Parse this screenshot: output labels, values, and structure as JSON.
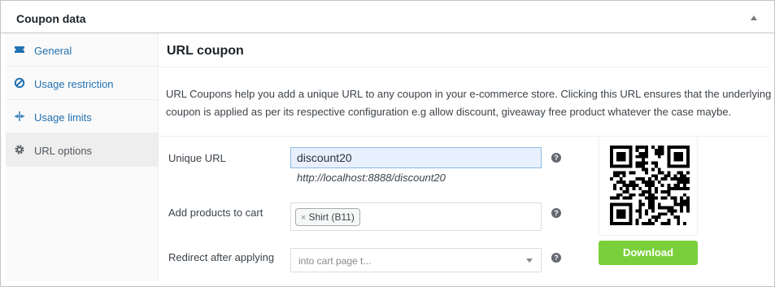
{
  "panel": {
    "title": "Coupon data"
  },
  "sidebar": {
    "items": [
      {
        "label": "General",
        "icon": "ticket-icon"
      },
      {
        "label": "Usage restriction",
        "icon": "block-icon"
      },
      {
        "label": "Usage limits",
        "icon": "limits-icon"
      },
      {
        "label": "URL options",
        "icon": "gear-icon",
        "active": true
      }
    ]
  },
  "main": {
    "title": "URL coupon",
    "description": "URL Coupons help you add a unique URL to any coupon in your e-commerce store. Clicking this URL ensures that the underlying coupon is applied as per its respective configuration e.g allow discount, giveaway free product whatever the case maybe.",
    "fields": {
      "unique_url": {
        "label": "Unique URL",
        "value": "discount20",
        "hint": "http://localhost:8888/discount20"
      },
      "add_products": {
        "label": "Add products to cart",
        "chip": "Shirt (B11)",
        "chip_remove": "×"
      },
      "redirect": {
        "label": "Redirect after applying",
        "placeholder": "into cart page t..."
      }
    },
    "help_glyph": "?",
    "download_label": "Download"
  },
  "colors": {
    "accent": "#2271b1",
    "download": "#7ad03a",
    "active_tab": "#eeeeee",
    "input_highlight": "#e8f0fe"
  }
}
